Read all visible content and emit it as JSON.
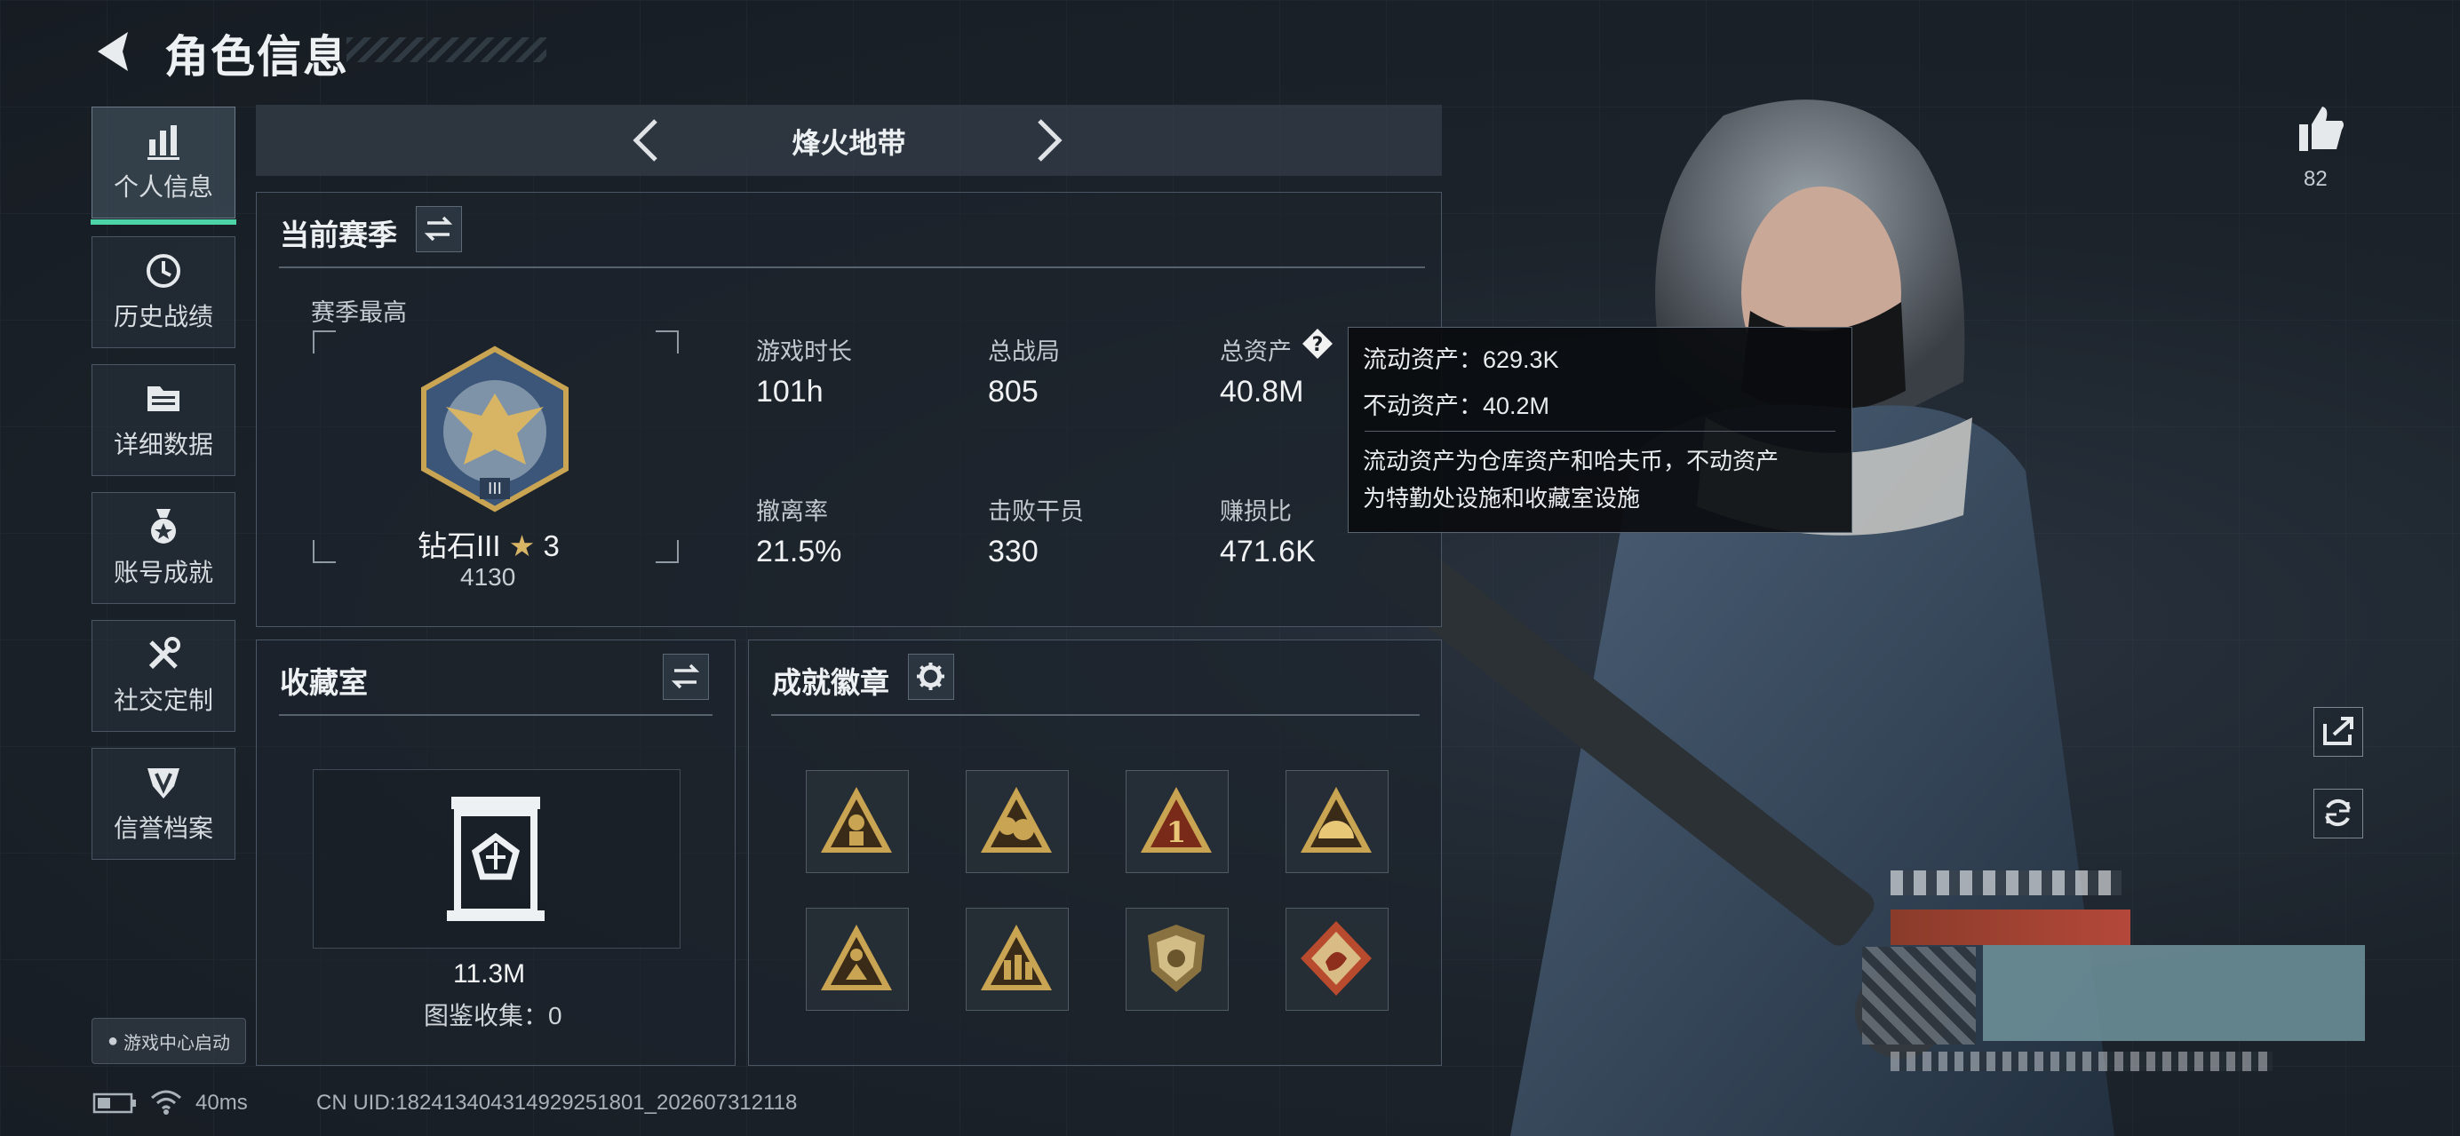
{
  "header": {
    "title": "角色信息"
  },
  "nav": {
    "items": [
      {
        "label": "个人信息",
        "icon": "bar-chart-icon",
        "active": true
      },
      {
        "label": "历史战绩",
        "icon": "history-clock-icon"
      },
      {
        "label": "详细数据",
        "icon": "folder-data-icon"
      },
      {
        "label": "账号成就",
        "icon": "medal-icon"
      },
      {
        "label": "社交定制",
        "icon": "tools-icon"
      },
      {
        "label": "信誉档案",
        "icon": "shield-icon"
      }
    ],
    "launcher": "游戏中心启动"
  },
  "mode": {
    "title": "烽火地带"
  },
  "season": {
    "title": "当前赛季",
    "best_label": "赛季最高",
    "rank_name": "钻石III",
    "rank_stars": "3",
    "rank_points": "4130",
    "stats": [
      {
        "label": "游戏时长",
        "value": "101h"
      },
      {
        "label": "总战局",
        "value": "805"
      },
      {
        "label": "总资产",
        "value": "40.8M"
      },
      {
        "label": "撤离率",
        "value": "21.5%"
      },
      {
        "label": "击败干员",
        "value": "330"
      },
      {
        "label": "赚损比",
        "value": "471.6K"
      }
    ]
  },
  "tooltip": {
    "liquid": "流动资产：629.3K",
    "fixed": "不动资产：40.2M",
    "desc_line1": "流动资产为仓库资产和哈夫币，不动资产",
    "desc_line2": "为特勤处设施和收藏室设施"
  },
  "collection": {
    "title": "收藏室",
    "value": "11.3M",
    "codex": "图鉴收集：0"
  },
  "badges": {
    "title": "成就徽章",
    "items": [
      "soldier-badge-icon",
      "treasure-badge-icon",
      "number-one-badge-icon",
      "sunrise-badge-icon",
      "sitting-figure-badge-icon",
      "squad-badge-icon",
      "lion-shield-badge-icon",
      "dragon-badge-icon"
    ]
  },
  "right": {
    "like_count": "82"
  },
  "status": {
    "ping": "40ms",
    "uid": "CN UID:18241340431492925​1801_202607312118"
  },
  "colors": {
    "accent": "#4ed2a8",
    "gold": "#c9a452",
    "panel_border": "#4a5663"
  }
}
